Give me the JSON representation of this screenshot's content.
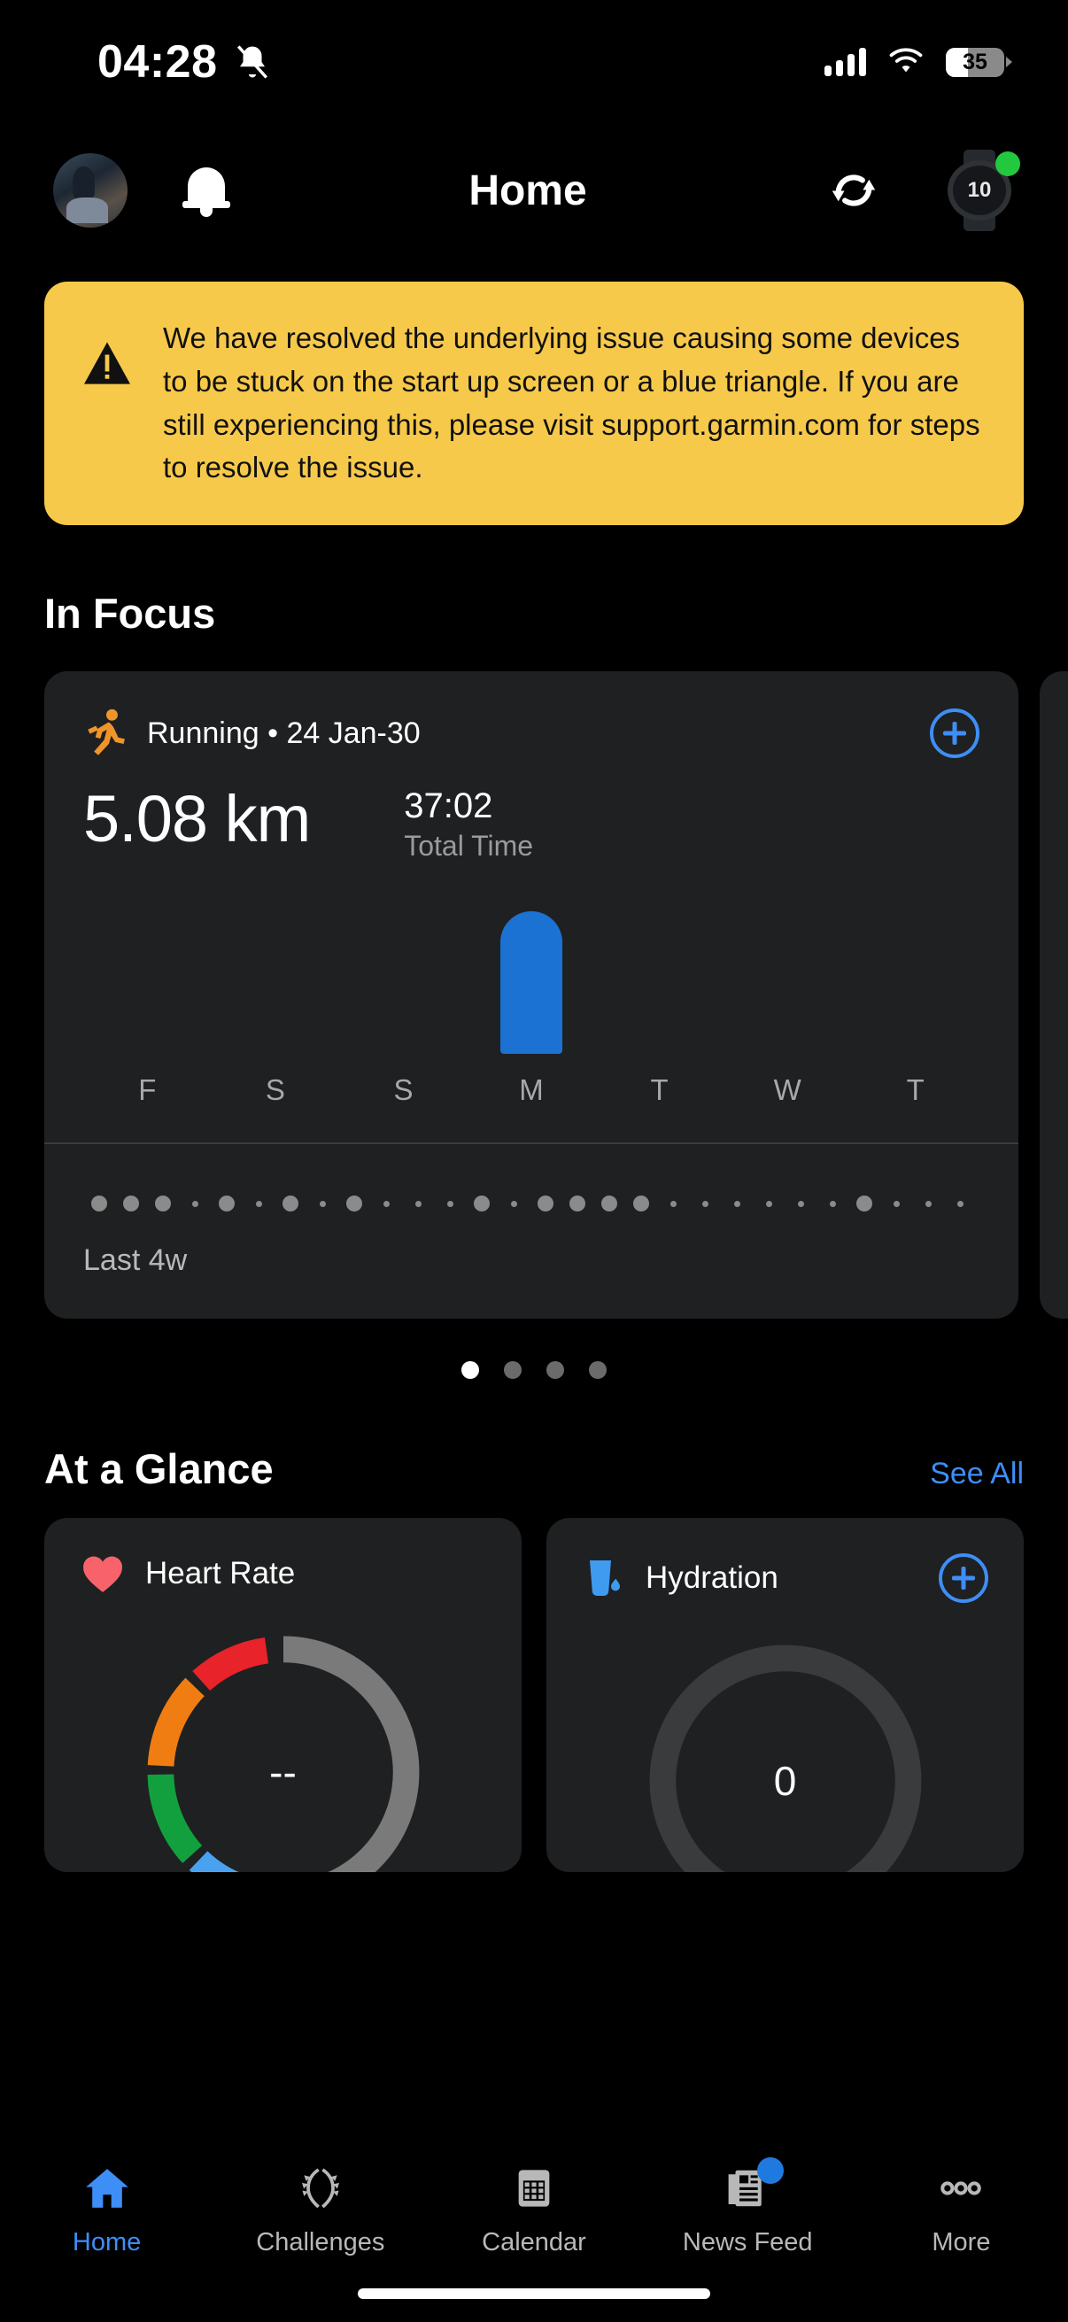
{
  "status_bar": {
    "time": "04:28",
    "mute_icon": "bell-slash-icon",
    "signal_icon": "cellular-signal-icon",
    "wifi_icon": "wifi-icon",
    "battery_level": "35",
    "battery_percent": 35
  },
  "header": {
    "avatar": "user-avatar",
    "notifications_icon": "bell-icon",
    "title": "Home",
    "sync_icon": "sync-icon",
    "device_icon": "watch-device-icon",
    "device_face_text": "10",
    "device_status": "connected"
  },
  "alert": {
    "icon": "warning-triangle-icon",
    "message": "We have resolved the underlying issue causing some devices to be stuck on the start up screen or a blue triangle. If you are still experiencing this, please visit support.garmin.com for steps to resolve the issue.",
    "background": "#f7c94b"
  },
  "in_focus": {
    "title": "In Focus",
    "card": {
      "activity_icon": "running-icon",
      "activity_label": "Running • 24 Jan-30",
      "add_icon": "plus-circle-icon",
      "distance": "5.08 km",
      "time_value": "37:02",
      "time_label": "Total Time",
      "history_label": "Last 4w"
    },
    "page_dots": {
      "count": 4,
      "active_index": 0
    }
  },
  "chart_data": {
    "type": "bar",
    "title": "Weekly running distance",
    "categories": [
      "F",
      "S",
      "S",
      "M",
      "T",
      "W",
      "T"
    ],
    "values": [
      0,
      0,
      0,
      5.08,
      0,
      0,
      0
    ],
    "ylabel": "km",
    "xlabel": "",
    "ylim": [
      0,
      5.5
    ],
    "grid": false,
    "legend": false,
    "bar_color": "#1b72d3"
  },
  "activity_dots": {
    "label": "Last 4w",
    "sizes": [
      18,
      18,
      18,
      7,
      18,
      7,
      18,
      7,
      18,
      7,
      7,
      7,
      18,
      7,
      18,
      18,
      18,
      18,
      7,
      7,
      7,
      7,
      7,
      7,
      18,
      7,
      7,
      7
    ],
    "color": "#8b8b8b"
  },
  "at_a_glance": {
    "title": "At a Glance",
    "see_all": "See All",
    "cards": [
      {
        "icon": "heart-icon",
        "title": "Heart Rate",
        "value": "--",
        "gauge_colors": [
          "#7a7a7a",
          "#49a2f0",
          "#12a03e",
          "#f07d12",
          "#e8232a"
        ]
      },
      {
        "icon": "hydration-glass-icon",
        "title": "Hydration",
        "add_icon": "plus-circle-icon",
        "value": "0",
        "gauge_colors": [
          "#3a3b3c"
        ]
      }
    ]
  },
  "tab_bar": {
    "items": [
      {
        "icon": "home-icon",
        "label": "Home",
        "active": true,
        "badge": false
      },
      {
        "icon": "laurel-wreath-icon",
        "label": "Challenges",
        "active": false,
        "badge": false
      },
      {
        "icon": "calendar-icon",
        "label": "Calendar",
        "active": false,
        "badge": false
      },
      {
        "icon": "news-feed-icon",
        "label": "News Feed",
        "active": false,
        "badge": true
      },
      {
        "icon": "more-dots-icon",
        "label": "More",
        "active": false,
        "badge": false
      }
    ],
    "accent_color": "#3e8ef7"
  }
}
